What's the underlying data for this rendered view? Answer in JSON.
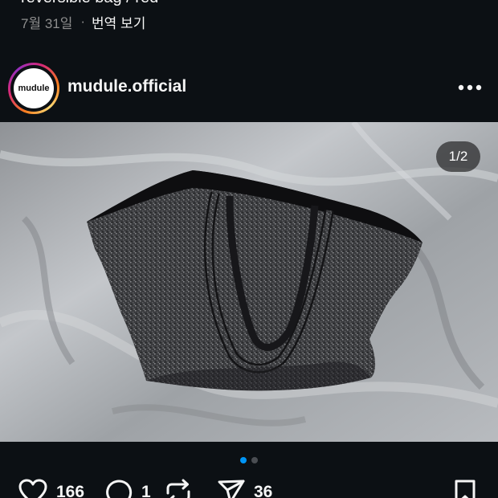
{
  "previous_post": {
    "caption": "reversible bag / red",
    "date": "7월 31일",
    "separator": "·",
    "translate_label": "번역 보기"
  },
  "post": {
    "avatar_text": "mudule",
    "username": "mudule.official",
    "more_icon": "more-horizontal-icon",
    "media": {
      "page_indicator": "1/2",
      "description_icon": "photo"
    },
    "carousel": {
      "total": 2,
      "active_index": 0
    },
    "actions": {
      "like_count": "166",
      "comment_count": "1",
      "share_count": "36",
      "icons": [
        "heart-icon",
        "comment-icon",
        "repost-icon",
        "send-icon",
        "bookmark-icon"
      ]
    }
  },
  "colors": {
    "background": "#0c1014",
    "text": "#f5f5f5",
    "muted": "#8e8e8e",
    "active_dot": "#0095f6",
    "inactive_dot": "#4a4d52"
  }
}
